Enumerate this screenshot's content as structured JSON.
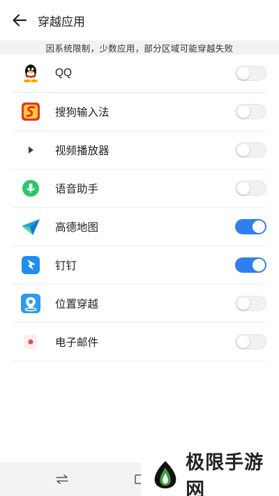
{
  "header": {
    "title": "穿越应用",
    "back_icon": "arrow-left-icon"
  },
  "notice": "因系统限制，少数应用，部分区域可能穿越失败",
  "apps": [
    {
      "label": "QQ",
      "icon": "qq-icon",
      "enabled": false
    },
    {
      "label": "搜狗输入法",
      "icon": "sogou-input-icon",
      "enabled": false
    },
    {
      "label": "视频播放器",
      "icon": "video-player-icon",
      "enabled": false
    },
    {
      "label": "语音助手",
      "icon": "voice-assistant-icon",
      "enabled": false
    },
    {
      "label": "高德地图",
      "icon": "amap-icon",
      "enabled": true
    },
    {
      "label": "钉钉",
      "icon": "dingtalk-icon",
      "enabled": true
    },
    {
      "label": "位置穿越",
      "icon": "location-icon",
      "enabled": false
    },
    {
      "label": "电子邮件",
      "icon": "email-icon",
      "enabled": false
    }
  ],
  "colors": {
    "accent": "#2f7ff0",
    "toggle_off": "#f1f1f1",
    "notice_bg": "#f2f2f2"
  },
  "navbar": {
    "icons": [
      "swap-icon",
      "square-icon"
    ]
  },
  "watermark": {
    "text": "极限手游网"
  }
}
